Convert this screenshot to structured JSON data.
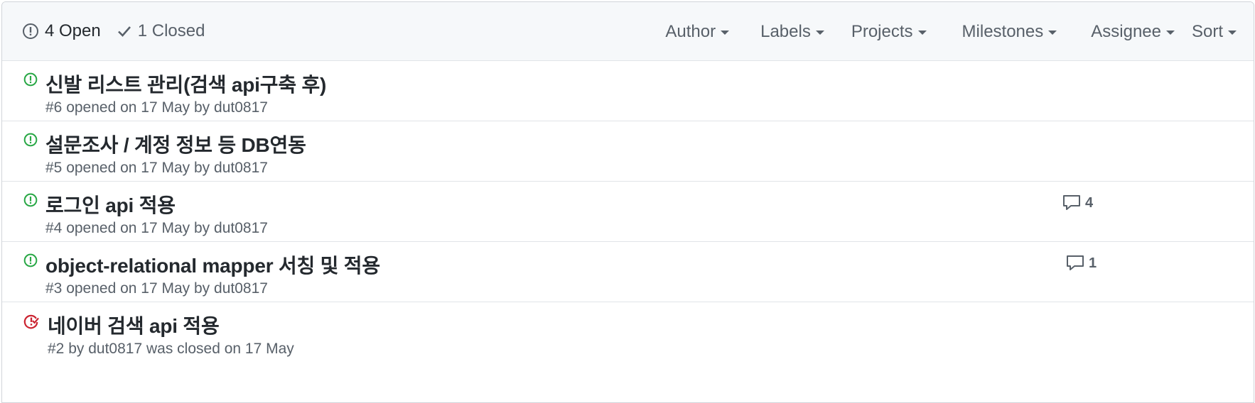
{
  "header": {
    "open_label": "4 Open",
    "closed_label": "1 Closed",
    "filters": [
      "Author",
      "Labels",
      "Projects",
      "Milestones",
      "Assignee",
      "Sort"
    ]
  },
  "colors": {
    "open": "#28a745",
    "closed": "#cb2431",
    "muted": "#586069"
  },
  "issues": [
    {
      "title": "신발 리스트 관리(검색 api구축 후)",
      "number": "#6",
      "opened_text": "opened on 17 May by",
      "author": "dut0817",
      "status": "open",
      "comments": ""
    },
    {
      "title": "설문조사 / 계정 정보 등 DB연동",
      "number": "#5",
      "opened_text": "opened on 17 May by",
      "author": "dut0817",
      "status": "open",
      "comments": ""
    },
    {
      "title": "로그인 api 적용",
      "number": "#4",
      "opened_text": "opened on 17 May by",
      "author": "dut0817",
      "status": "open",
      "comments": "4"
    },
    {
      "title": "object-relational mapper 서칭 및 적용",
      "number": "#3",
      "opened_text": "opened on 17 May by",
      "author": "dut0817",
      "status": "open",
      "comments": "1"
    },
    {
      "title": "네이버 검색 api 적용",
      "number": "#2",
      "by_text": "by",
      "author": "dut0817",
      "closed_text": "was closed on 17 May",
      "status": "closed"
    }
  ]
}
